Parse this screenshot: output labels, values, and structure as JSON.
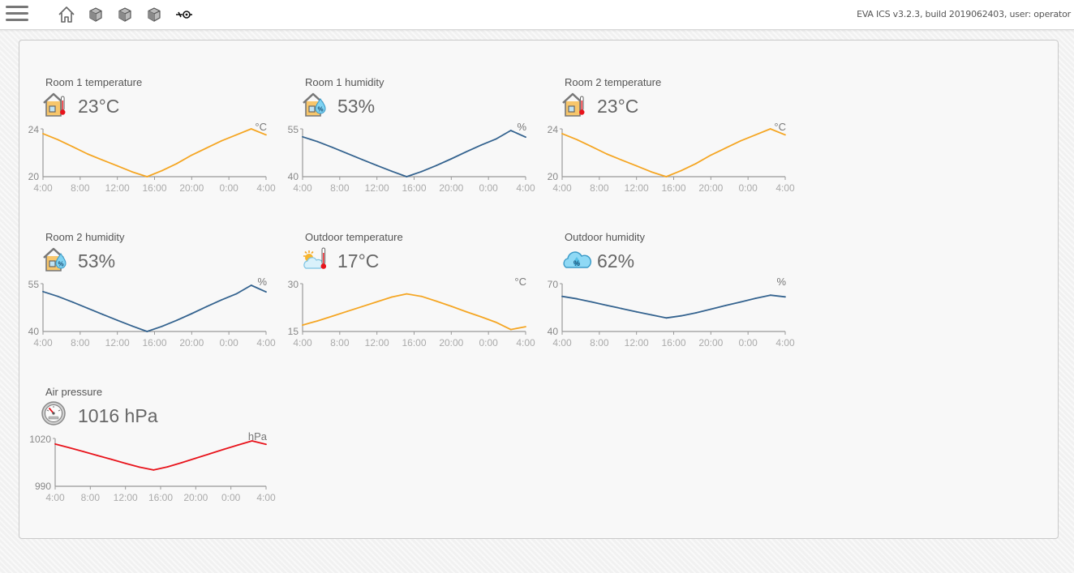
{
  "header": {
    "app_info": "EVA ICS v3.2.3, build 2019062403, user: operator",
    "nav_icons": [
      "home-icon",
      "cube-icon",
      "cube-icon",
      "cube-icon",
      "sensor-icon"
    ]
  },
  "colors": {
    "temperature": "#f5a623",
    "humidity": "#34638f",
    "pressure": "#e8131b"
  },
  "widgets": [
    {
      "title": "Room 1 temperature",
      "value": "23°C",
      "icon": "house-thermometer-icon",
      "chart_data": {
        "type": "line",
        "unit": "°C",
        "ylim": [
          20,
          24
        ],
        "yticks": [
          "24",
          "20"
        ],
        "x": [
          "4:00",
          "8:00",
          "12:00",
          "16:00",
          "20:00",
          "0:00",
          "4:00"
        ],
        "series": [
          {
            "color": "#f5a623",
            "values": [
              23.6,
              23.1,
              22.5,
              21.9,
              21.4,
              20.9,
              20.4,
              20.0,
              20.5,
              21.1,
              21.8,
              22.4,
              23.0,
              23.5,
              24.0,
              23.5
            ]
          }
        ]
      }
    },
    {
      "title": "Room 1 humidity",
      "value": "53%",
      "icon": "house-humidity-icon",
      "chart_data": {
        "type": "line",
        "unit": "%",
        "ylim": [
          40,
          55
        ],
        "yticks": [
          "55",
          "40"
        ],
        "x": [
          "4:00",
          "8:00",
          "12:00",
          "16:00",
          "20:00",
          "0:00",
          "4:00"
        ],
        "series": [
          {
            "color": "#34638f",
            "values": [
              52.5,
              51.0,
              49.2,
              47.3,
              45.4,
              43.5,
              41.7,
              40.0,
              41.6,
              43.5,
              45.6,
              47.8,
              49.9,
              51.8,
              54.5,
              52.4
            ]
          }
        ]
      }
    },
    {
      "title": "Room 2 temperature",
      "value": "23°C",
      "icon": "house-thermometer-icon",
      "chart_data": {
        "type": "line",
        "unit": "°C",
        "ylim": [
          20,
          24
        ],
        "yticks": [
          "24",
          "20"
        ],
        "x": [
          "4:00",
          "8:00",
          "12:00",
          "16:00",
          "20:00",
          "0:00",
          "4:00"
        ],
        "series": [
          {
            "color": "#f5a623",
            "values": [
              23.6,
              23.1,
              22.5,
              21.9,
              21.4,
              20.9,
              20.4,
              20.0,
              20.5,
              21.1,
              21.8,
              22.4,
              23.0,
              23.5,
              24.0,
              23.5
            ]
          }
        ]
      }
    },
    {
      "title": "Room 2 humidity",
      "value": "53%",
      "icon": "house-humidity-icon",
      "chart_data": {
        "type": "line",
        "unit": "%",
        "ylim": [
          40,
          55
        ],
        "yticks": [
          "55",
          "40"
        ],
        "x": [
          "4:00",
          "8:00",
          "12:00",
          "16:00",
          "20:00",
          "0:00",
          "4:00"
        ],
        "series": [
          {
            "color": "#34638f",
            "values": [
              52.5,
              51.0,
              49.2,
              47.3,
              45.4,
              43.5,
              41.7,
              40.0,
              41.6,
              43.5,
              45.6,
              47.8,
              49.9,
              51.8,
              54.5,
              52.4
            ]
          }
        ]
      }
    },
    {
      "title": "Outdoor temperature",
      "value": "17°C",
      "icon": "sun-cloud-thermometer-icon",
      "chart_data": {
        "type": "line",
        "unit": "°C",
        "ylim": [
          15,
          30
        ],
        "yticks": [
          "30",
          "15"
        ],
        "x": [
          "4:00",
          "8:00",
          "12:00",
          "16:00",
          "20:00",
          "0:00",
          "4:00"
        ],
        "series": [
          {
            "color": "#f5a623",
            "values": [
              17.0,
              18.3,
              19.8,
              21.3,
              22.8,
              24.3,
              25.8,
              26.8,
              26.0,
              24.5,
              22.9,
              21.2,
              19.6,
              17.9,
              15.6,
              16.5
            ]
          }
        ]
      }
    },
    {
      "title": "Outdoor humidity",
      "value": "62%",
      "icon": "cloud-humidity-icon",
      "chart_data": {
        "type": "line",
        "unit": "%",
        "ylim": [
          40,
          70
        ],
        "yticks": [
          "70",
          "40"
        ],
        "x": [
          "4:00",
          "8:00",
          "12:00",
          "16:00",
          "20:00",
          "0:00",
          "4:00"
        ],
        "series": [
          {
            "color": "#34638f",
            "values": [
              62.0,
              60.5,
              58.5,
              56.4,
              54.4,
              52.3,
              50.4,
              48.5,
              49.8,
              51.7,
              54.0,
              56.3,
              58.5,
              60.8,
              62.8,
              61.7
            ]
          }
        ]
      }
    },
    {
      "title": "Air pressure",
      "value": "1016 hPa",
      "icon": "barometer-icon",
      "chart_data": {
        "type": "line",
        "unit": "hPa",
        "ylim": [
          990,
          1020
        ],
        "yticks": [
          "1020",
          "990"
        ],
        "x": [
          "4:00",
          "8:00",
          "12:00",
          "16:00",
          "20:00",
          "0:00",
          "4:00"
        ],
        "series": [
          {
            "color": "#e8131b",
            "values": [
              1016.5,
              1014.2,
              1011.8,
              1009.3,
              1006.9,
              1004.4,
              1002.0,
              1000.2,
              1002.2,
              1004.8,
              1007.6,
              1010.4,
              1013.2,
              1015.9,
              1018.5,
              1016.3
            ]
          }
        ]
      }
    }
  ]
}
